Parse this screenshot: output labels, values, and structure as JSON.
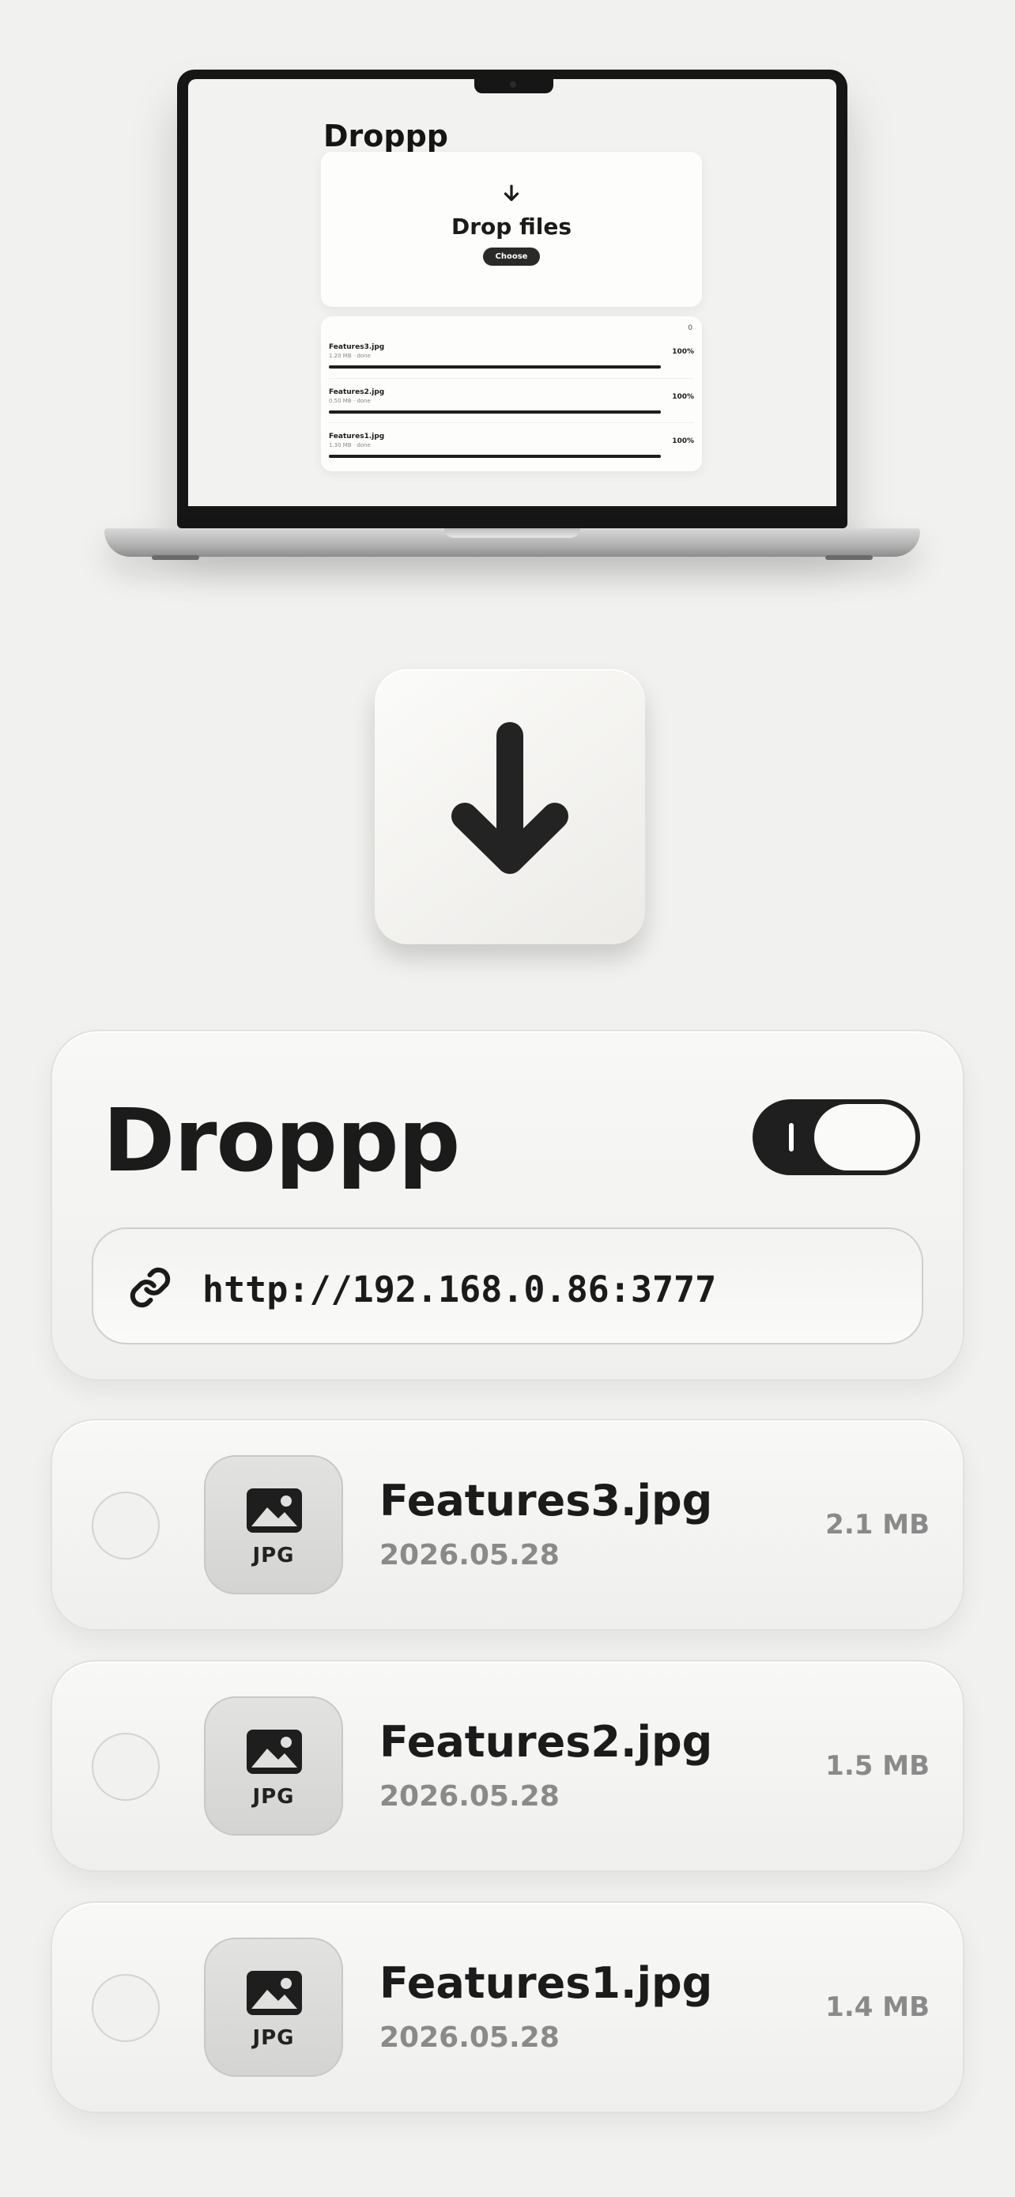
{
  "mockup": {
    "title": "Droppp",
    "drop_title": "Drop files",
    "choose_label": "Choose",
    "count": "0",
    "files": [
      {
        "name": "Features3.jpg",
        "meta": "1.20 MB · done",
        "percent": "100%",
        "progress": 1.0
      },
      {
        "name": "Features2.jpg",
        "meta": "0.50 MB · done",
        "percent": "100%",
        "progress": 1.0
      },
      {
        "name": "Features1.jpg",
        "meta": "1.30 MB · done",
        "percent": "100%",
        "progress": 1.0
      }
    ]
  },
  "widget": {
    "title": "Droppp",
    "toggle_on": true,
    "url": "http://192.168.0.86:3777"
  },
  "files": [
    {
      "name": "Features3.jpg",
      "date": "2026.05.28",
      "size": "2.1 MB",
      "type": "JPG"
    },
    {
      "name": "Features2.jpg",
      "date": "2026.05.28",
      "size": "1.5 MB",
      "type": "JPG"
    },
    {
      "name": "Features1.jpg",
      "date": "2026.05.28",
      "size": "1.4 MB",
      "type": "JPG"
    }
  ],
  "colors": {
    "background": "#f1f1ef",
    "ink": "#1b1b1b",
    "muted": "#8a8a8a"
  }
}
